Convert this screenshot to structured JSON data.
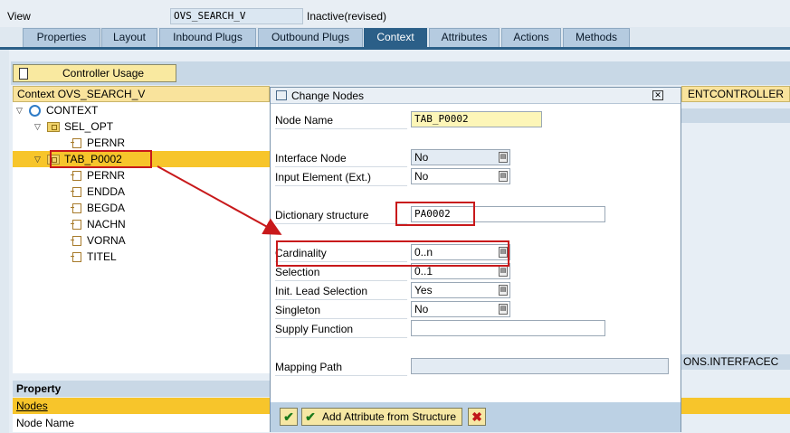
{
  "header": {
    "view_label": "View",
    "view_name": "OVS_SEARCH_V",
    "status": "Inactive(revised)"
  },
  "tabs": [
    {
      "label": "Properties"
    },
    {
      "label": "Layout"
    },
    {
      "label": "Inbound Plugs"
    },
    {
      "label": "Outbound Plugs"
    },
    {
      "label": "Context"
    },
    {
      "label": "Attributes"
    },
    {
      "label": "Actions"
    },
    {
      "label": "Methods"
    }
  ],
  "active_tab": "Context",
  "toolbar": {
    "controller_usage_label": "Controller Usage"
  },
  "tree": {
    "header": "Context OVS_SEARCH_V",
    "rows": [
      {
        "label": "CONTEXT"
      },
      {
        "label": "SEL_OPT"
      },
      {
        "label": "PERNR"
      },
      {
        "label": "TAB_P0002"
      },
      {
        "label": "PERNR"
      },
      {
        "label": "ENDDA"
      },
      {
        "label": "BEGDA"
      },
      {
        "label": "NACHN"
      },
      {
        "label": "VORNA"
      },
      {
        "label": "TITEL"
      }
    ]
  },
  "right_panel": {
    "controller_fragment": "ENTCONTROLLER",
    "mapping_fragment": "ONS.INTERFACEC"
  },
  "property": {
    "header": "Property",
    "nodes_link": "Nodes",
    "node_name_label": "Node Name"
  },
  "dialog": {
    "title": "Change Nodes",
    "fields": {
      "node_name": {
        "label": "Node Name",
        "value": "TAB_P0002"
      },
      "interface_node": {
        "label": "Interface Node",
        "value": "No"
      },
      "input_element": {
        "label": "Input Element (Ext.)",
        "value": "No"
      },
      "dictionary_structure": {
        "label": "Dictionary structure",
        "value": "PA0002"
      },
      "cardinality": {
        "label": "Cardinality",
        "value": "0..n"
      },
      "selection": {
        "label": "Selection",
        "value": "0..1"
      },
      "init_lead_selection": {
        "label": "Init. Lead Selection",
        "value": "Yes"
      },
      "singleton": {
        "label": "Singleton",
        "value": "No"
      },
      "supply_function": {
        "label": "Supply Function",
        "value": ""
      },
      "mapping_path": {
        "label": "Mapping Path",
        "value": ""
      }
    },
    "footer": {
      "add_attr_label": "Add Attribute from Structure"
    }
  },
  "colors": {
    "tab_active": "#2b5f88",
    "highlight": "#f7c52b",
    "annotation_red": "#c8191b"
  }
}
